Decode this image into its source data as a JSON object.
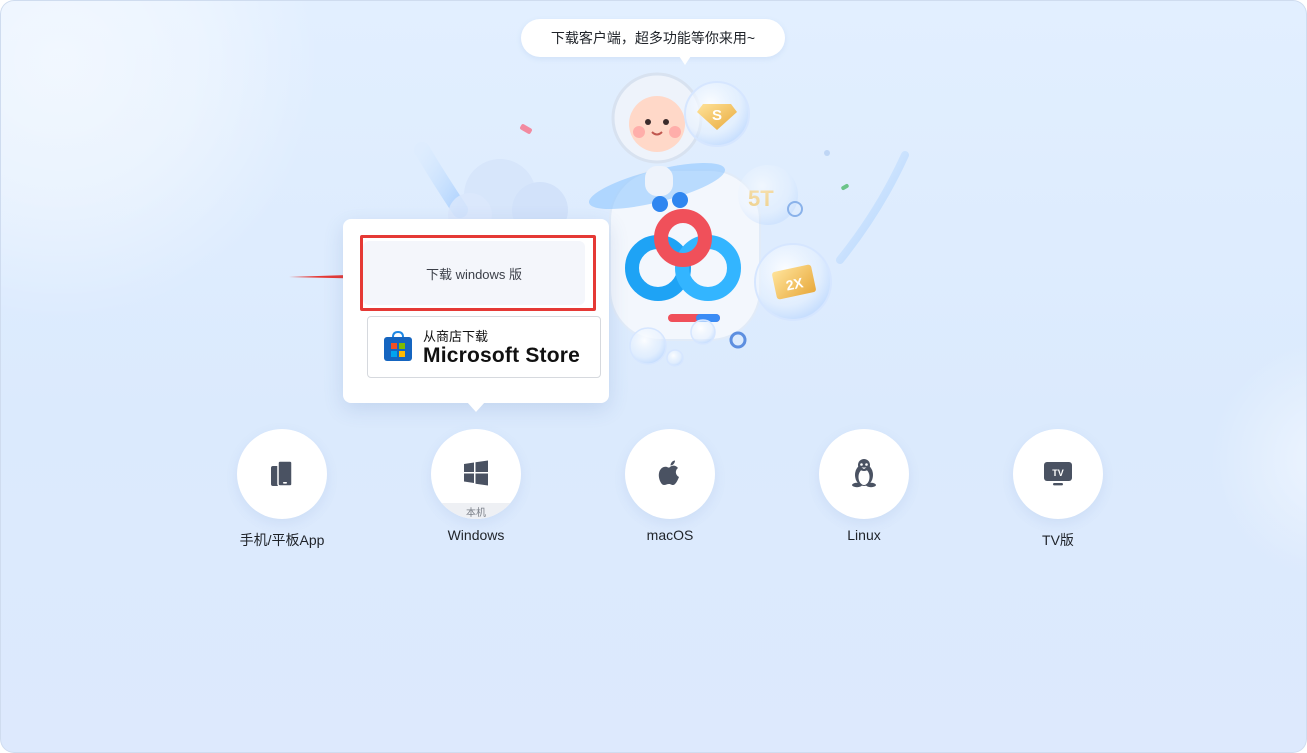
{
  "header": {
    "bubble_text": "下载客户端，超多功能等你来用~"
  },
  "hero": {
    "badge_storage": "5T",
    "badge_speed": "2X",
    "badge_coin": "S"
  },
  "popup": {
    "download_windows_label": "下载 windows 版",
    "store": {
      "subtitle": "从商店下载",
      "title": "Microsoft Store"
    }
  },
  "platforms": [
    {
      "label": "手机/平板App",
      "icon": "phone-tablet-icon"
    },
    {
      "label": "Windows",
      "icon": "windows-logo-icon",
      "tag": "本机"
    },
    {
      "label": "macOS",
      "icon": "apple-logo-icon"
    },
    {
      "label": "Linux",
      "icon": "linux-penguin-icon"
    },
    {
      "label": "TV版",
      "icon": "tv-icon",
      "icon_text": "TV"
    }
  ],
  "colors": {
    "highlight": "#e53935",
    "arrow": "#e53935",
    "brand_red": "#f0505a",
    "brand_blue": "#1ea3f5",
    "icon_dark": "#4a5262"
  }
}
